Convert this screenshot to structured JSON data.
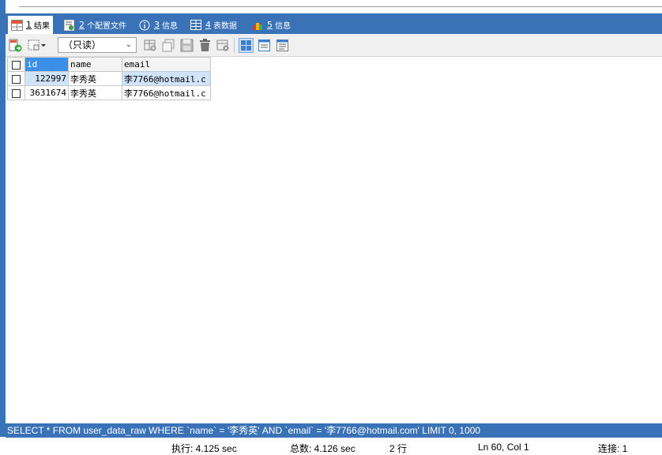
{
  "tabs": [
    {
      "num": "1",
      "label": "结果",
      "icon": "results-grid-icon",
      "active": true
    },
    {
      "num": "2",
      "label": "个配置文件",
      "icon": "profile-icon",
      "active": false
    },
    {
      "num": "3",
      "label": "信息",
      "icon": "info-icon",
      "active": false
    },
    {
      "num": "4",
      "label": "表数据",
      "icon": "table-data-icon",
      "active": false
    },
    {
      "num": "5",
      "label": "信息",
      "icon": "info-history-icon",
      "active": false
    }
  ],
  "toolbar": {
    "readonly_value": "（只读）",
    "icons": [
      "export-icon",
      "grid-options-icon",
      "insert-row-icon",
      "duplicate-row-icon",
      "save-icon",
      "delete-icon",
      "cancel-icon",
      "grid-view-icon",
      "form-view-icon",
      "text-view-icon"
    ]
  },
  "grid": {
    "columns": [
      "id",
      "name",
      "email"
    ],
    "rows": [
      {
        "id": "122997",
        "name": "李秀英",
        "email": "李7766@hotmail.c"
      },
      {
        "id": "3631674",
        "name": "李秀英",
        "email": "李7766@hotmail.c"
      }
    ]
  },
  "sql": "SELECT * FROM user_data_raw WHERE `name` = '李秀英' AND `email` = '李7766@hotmail.com' LIMIT 0, 1000",
  "status": {
    "exec_time": "执行: 4.125 sec",
    "total_time": "总数: 4.126 sec",
    "rows": "2 行",
    "position": "Ln 60, Col 1",
    "connections": "连接: 1"
  },
  "colors": {
    "frame": "#3a72b8",
    "header_selected": "#3b8fe8",
    "row_selected": "#cfe3f9"
  }
}
